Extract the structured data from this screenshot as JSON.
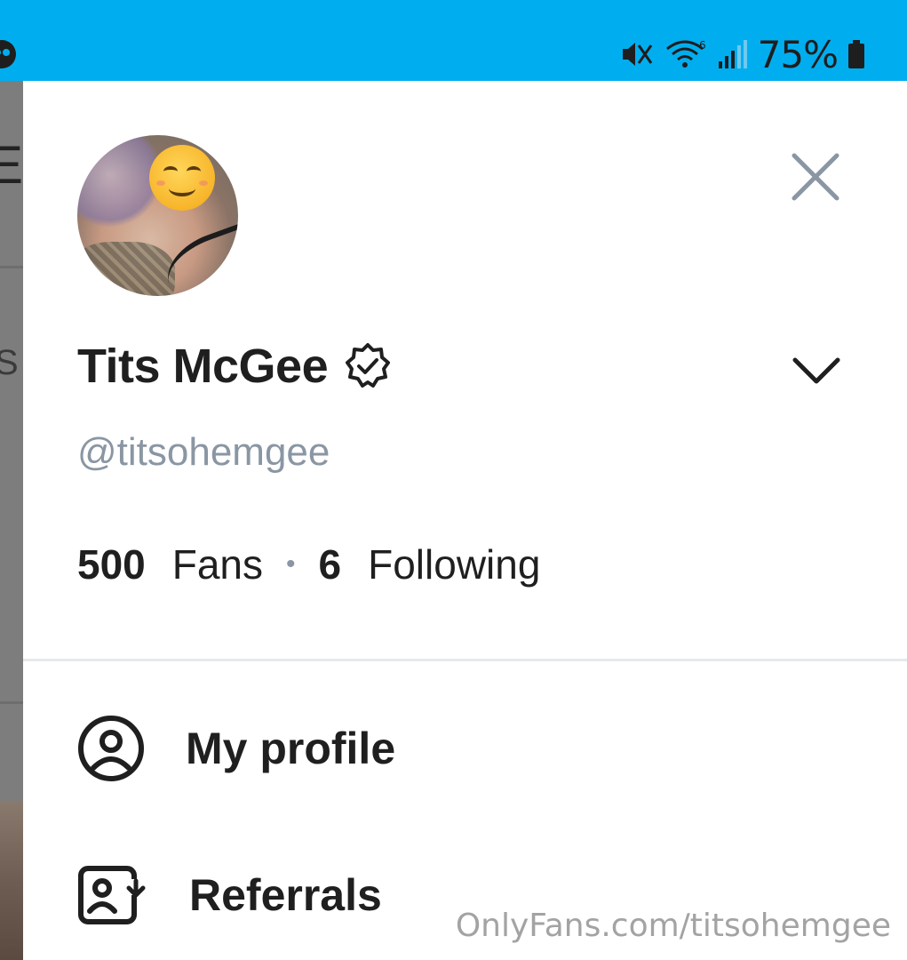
{
  "status_bar": {
    "battery_percent": "75%",
    "icons": [
      "mute-icon",
      "wifi-icon",
      "signal-icon",
      "battery-icon"
    ],
    "wifi_badge": "6"
  },
  "profile": {
    "display_name": "Tits McGee",
    "handle": "@titsohemgee",
    "verified": true,
    "fans_count": "500",
    "fans_label": "Fans",
    "following_count": "6",
    "following_label": "Following"
  },
  "menu": {
    "my_profile_label": "My profile",
    "referrals_label": "Referrals"
  },
  "watermark": "OnlyFans.com/titsohemgee",
  "colors": {
    "status_bar": "#00aeef",
    "handle_text": "#8a96a3",
    "close_icon": "#8a96a3"
  }
}
